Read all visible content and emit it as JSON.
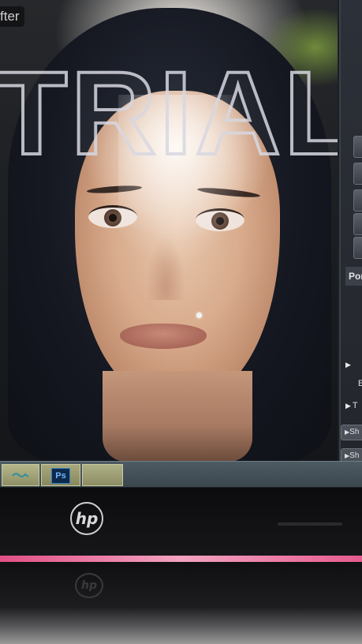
{
  "window": {
    "view_label": "fter"
  },
  "canvas": {
    "watermark_text": "TRIAL"
  },
  "side_panel": {
    "tab_label": "Por",
    "rows": [
      {
        "label": ""
      },
      {
        "label": "E"
      },
      {
        "label": "T"
      }
    ],
    "buttons": [
      {
        "label": "Sh"
      },
      {
        "label": "Sh"
      }
    ]
  },
  "taskbar": {
    "items": [
      {
        "icon": "wave-icon"
      },
      {
        "icon": "photoshop-icon",
        "label": "Ps"
      },
      {
        "icon": "blank"
      }
    ]
  },
  "device": {
    "brand": "hp"
  },
  "colors": {
    "taskbar": "#4d5b63",
    "photoshop_blue": "#6fb5ff",
    "pink_strip": "#e24f86"
  }
}
